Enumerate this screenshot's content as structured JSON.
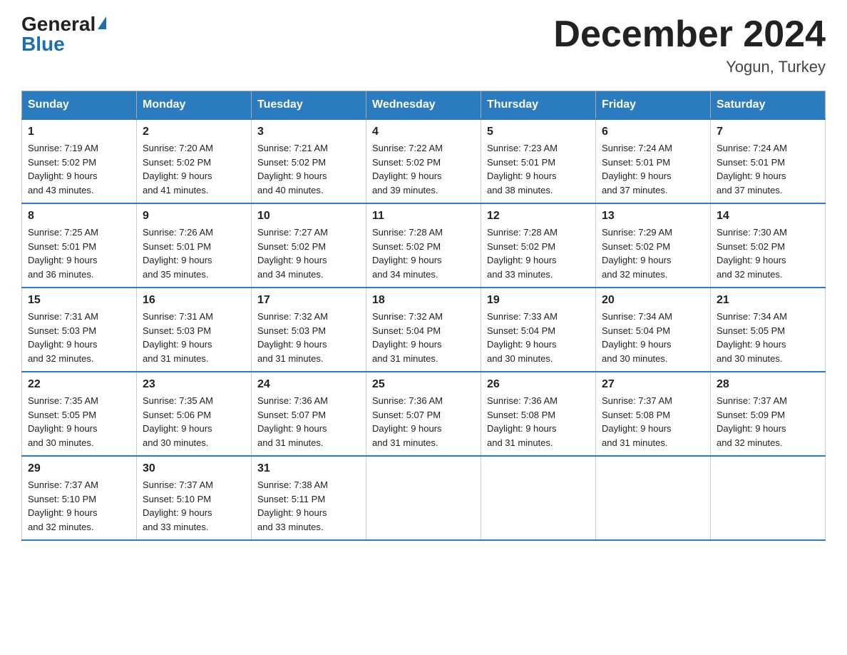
{
  "logo": {
    "general": "General",
    "blue": "Blue"
  },
  "header": {
    "month_year": "December 2024",
    "location": "Yogun, Turkey"
  },
  "days_of_week": [
    "Sunday",
    "Monday",
    "Tuesday",
    "Wednesday",
    "Thursday",
    "Friday",
    "Saturday"
  ],
  "weeks": [
    [
      {
        "day": "1",
        "sunrise": "7:19 AM",
        "sunset": "5:02 PM",
        "daylight": "9 hours and 43 minutes."
      },
      {
        "day": "2",
        "sunrise": "7:20 AM",
        "sunset": "5:02 PM",
        "daylight": "9 hours and 41 minutes."
      },
      {
        "day": "3",
        "sunrise": "7:21 AM",
        "sunset": "5:02 PM",
        "daylight": "9 hours and 40 minutes."
      },
      {
        "day": "4",
        "sunrise": "7:22 AM",
        "sunset": "5:02 PM",
        "daylight": "9 hours and 39 minutes."
      },
      {
        "day": "5",
        "sunrise": "7:23 AM",
        "sunset": "5:01 PM",
        "daylight": "9 hours and 38 minutes."
      },
      {
        "day": "6",
        "sunrise": "7:24 AM",
        "sunset": "5:01 PM",
        "daylight": "9 hours and 37 minutes."
      },
      {
        "day": "7",
        "sunrise": "7:24 AM",
        "sunset": "5:01 PM",
        "daylight": "9 hours and 37 minutes."
      }
    ],
    [
      {
        "day": "8",
        "sunrise": "7:25 AM",
        "sunset": "5:01 PM",
        "daylight": "9 hours and 36 minutes."
      },
      {
        "day": "9",
        "sunrise": "7:26 AM",
        "sunset": "5:01 PM",
        "daylight": "9 hours and 35 minutes."
      },
      {
        "day": "10",
        "sunrise": "7:27 AM",
        "sunset": "5:02 PM",
        "daylight": "9 hours and 34 minutes."
      },
      {
        "day": "11",
        "sunrise": "7:28 AM",
        "sunset": "5:02 PM",
        "daylight": "9 hours and 34 minutes."
      },
      {
        "day": "12",
        "sunrise": "7:28 AM",
        "sunset": "5:02 PM",
        "daylight": "9 hours and 33 minutes."
      },
      {
        "day": "13",
        "sunrise": "7:29 AM",
        "sunset": "5:02 PM",
        "daylight": "9 hours and 32 minutes."
      },
      {
        "day": "14",
        "sunrise": "7:30 AM",
        "sunset": "5:02 PM",
        "daylight": "9 hours and 32 minutes."
      }
    ],
    [
      {
        "day": "15",
        "sunrise": "7:31 AM",
        "sunset": "5:03 PM",
        "daylight": "9 hours and 32 minutes."
      },
      {
        "day": "16",
        "sunrise": "7:31 AM",
        "sunset": "5:03 PM",
        "daylight": "9 hours and 31 minutes."
      },
      {
        "day": "17",
        "sunrise": "7:32 AM",
        "sunset": "5:03 PM",
        "daylight": "9 hours and 31 minutes."
      },
      {
        "day": "18",
        "sunrise": "7:32 AM",
        "sunset": "5:04 PM",
        "daylight": "9 hours and 31 minutes."
      },
      {
        "day": "19",
        "sunrise": "7:33 AM",
        "sunset": "5:04 PM",
        "daylight": "9 hours and 30 minutes."
      },
      {
        "day": "20",
        "sunrise": "7:34 AM",
        "sunset": "5:04 PM",
        "daylight": "9 hours and 30 minutes."
      },
      {
        "day": "21",
        "sunrise": "7:34 AM",
        "sunset": "5:05 PM",
        "daylight": "9 hours and 30 minutes."
      }
    ],
    [
      {
        "day": "22",
        "sunrise": "7:35 AM",
        "sunset": "5:05 PM",
        "daylight": "9 hours and 30 minutes."
      },
      {
        "day": "23",
        "sunrise": "7:35 AM",
        "sunset": "5:06 PM",
        "daylight": "9 hours and 30 minutes."
      },
      {
        "day": "24",
        "sunrise": "7:36 AM",
        "sunset": "5:07 PM",
        "daylight": "9 hours and 31 minutes."
      },
      {
        "day": "25",
        "sunrise": "7:36 AM",
        "sunset": "5:07 PM",
        "daylight": "9 hours and 31 minutes."
      },
      {
        "day": "26",
        "sunrise": "7:36 AM",
        "sunset": "5:08 PM",
        "daylight": "9 hours and 31 minutes."
      },
      {
        "day": "27",
        "sunrise": "7:37 AM",
        "sunset": "5:08 PM",
        "daylight": "9 hours and 31 minutes."
      },
      {
        "day": "28",
        "sunrise": "7:37 AM",
        "sunset": "5:09 PM",
        "daylight": "9 hours and 32 minutes."
      }
    ],
    [
      {
        "day": "29",
        "sunrise": "7:37 AM",
        "sunset": "5:10 PM",
        "daylight": "9 hours and 32 minutes."
      },
      {
        "day": "30",
        "sunrise": "7:37 AM",
        "sunset": "5:10 PM",
        "daylight": "9 hours and 33 minutes."
      },
      {
        "day": "31",
        "sunrise": "7:38 AM",
        "sunset": "5:11 PM",
        "daylight": "9 hours and 33 minutes."
      },
      null,
      null,
      null,
      null
    ]
  ],
  "labels": {
    "sunrise": "Sunrise:",
    "sunset": "Sunset:",
    "daylight": "Daylight:"
  }
}
